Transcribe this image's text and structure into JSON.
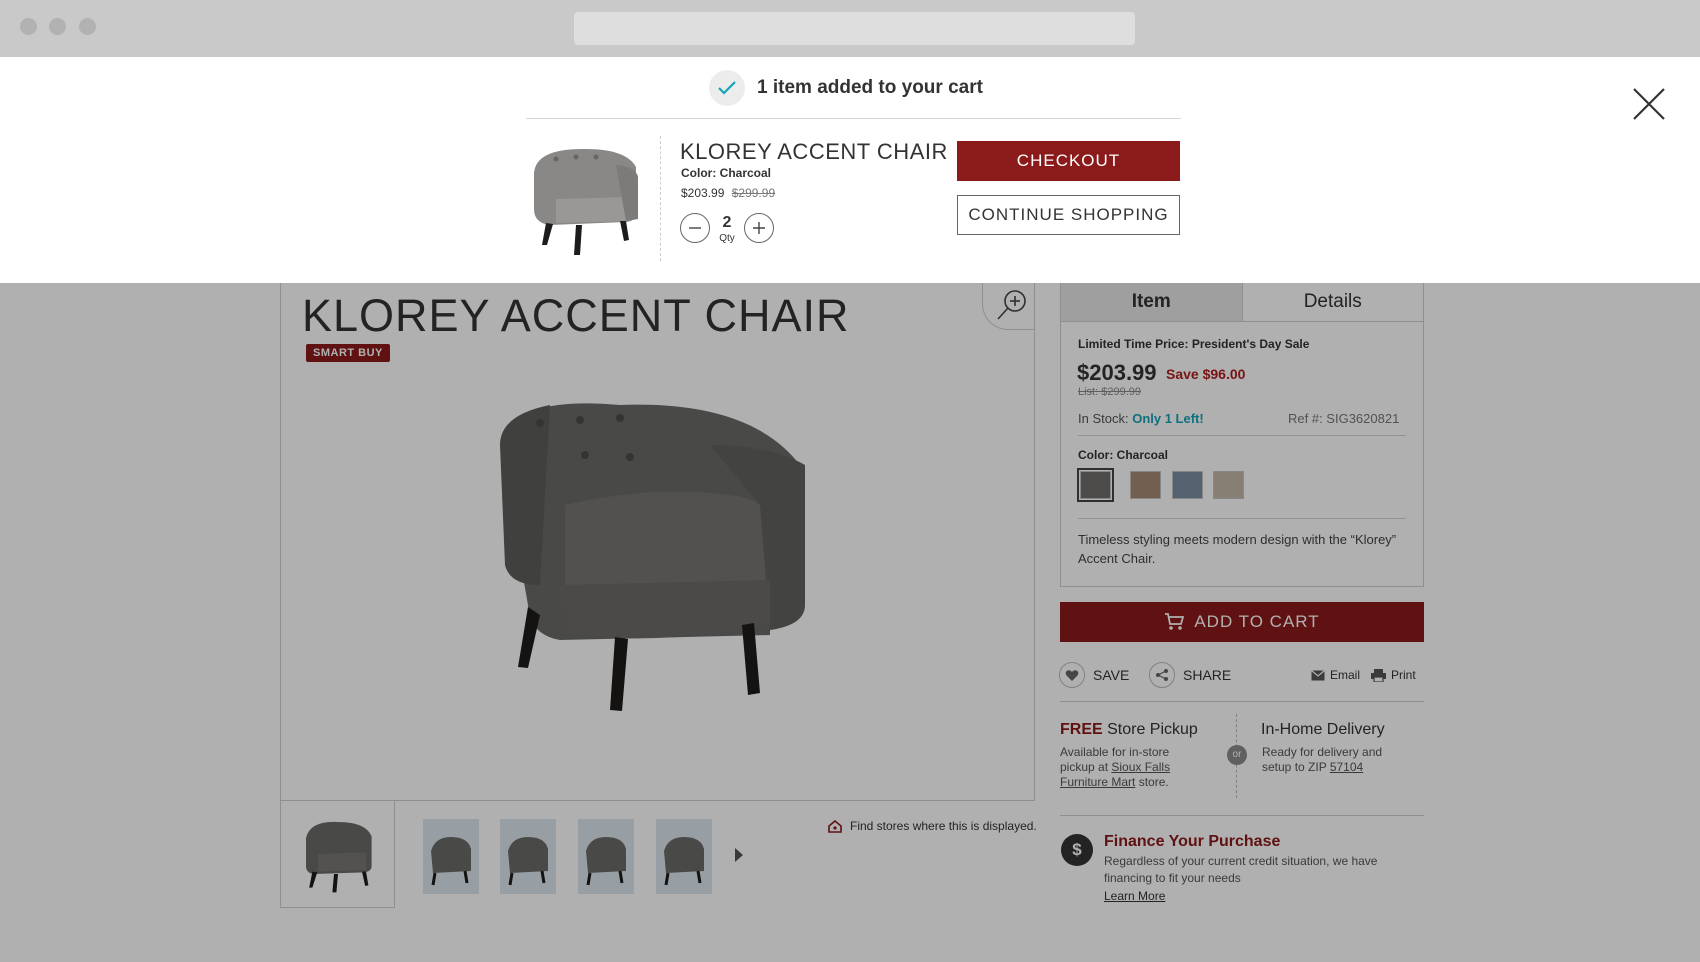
{
  "modal": {
    "added_message": "1 item added to your cart",
    "product_name": "KLOREY ACCENT CHAIR",
    "color": "Color: Charcoal",
    "price": "$203.99",
    "old_price": "$299.99",
    "qty": "2",
    "qty_label": "Qty",
    "checkout_label": "CHECKOUT",
    "continue_label": "CONTINUE SHOPPING"
  },
  "product": {
    "title": "KLOREY ACCENT CHAIR",
    "badge": "SMART BUY",
    "find_stores": "Find stores where this is displayed."
  },
  "tabs": [
    {
      "label": "Item",
      "active": true
    },
    {
      "label": "Details",
      "active": false
    }
  ],
  "panel": {
    "limited": "Limited Time Price: President's Day Sale",
    "price": "$203.99",
    "save": "Save $96.00",
    "list": "List: $299.99",
    "stock_label": "In Stock: ",
    "stock_value": "Only 1 Left!",
    "ref": "Ref #: SIG3620821",
    "color_label": "Color: Charcoal",
    "swatches": [
      "#6f6d6b",
      "#a68a74",
      "#7c8ea3",
      "#c4b7a8"
    ],
    "description": "Timeless styling meets modern design with the “Klorey” Accent Chair."
  },
  "actions": {
    "add_to_cart": "ADD TO CART",
    "save": "SAVE",
    "share": "SHARE",
    "email": "Email",
    "print": "Print"
  },
  "pickup": {
    "free": "FREE",
    "title": " Store Pickup",
    "text_before": "Available for in-store pickup at ",
    "store": "Sioux Falls Furniture Mart",
    "text_after": " store."
  },
  "or_label": "or",
  "delivery": {
    "title": "In-Home Delivery",
    "text": "Ready for delivery and setup to ZIP ",
    "zip": "57104"
  },
  "finance": {
    "icon": "$",
    "title": "Finance Your Purchase",
    "text": "Regardless of your current credit situation, we have financing to fit your needs",
    "link": "Learn More"
  },
  "colors": {
    "brand_red": "#8b1a1a",
    "accent_teal": "#17a2b8"
  }
}
